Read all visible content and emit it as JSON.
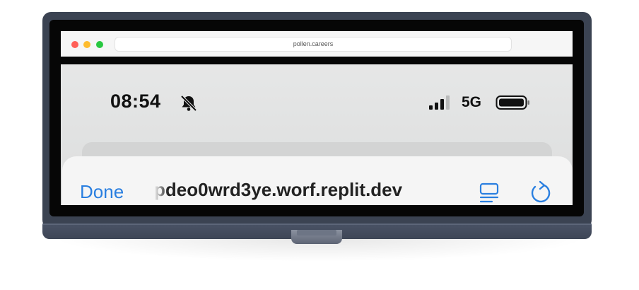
{
  "browser": {
    "url": "pollen.careers"
  },
  "status_bar": {
    "time": "08:54",
    "network": "5G",
    "icons": [
      "bell-slash-icon",
      "signal-icon",
      "battery-icon"
    ]
  },
  "sheet": {
    "done_label": "Done",
    "url_text": "pdeo0wrd3ye.worf.replit.dev",
    "icons": [
      "reader-icon",
      "reload-icon"
    ]
  },
  "colors": {
    "accent": "#2a7fe0",
    "traffic_red": "#ff5f57",
    "traffic_yellow": "#febc2e",
    "traffic_green": "#28c840"
  }
}
